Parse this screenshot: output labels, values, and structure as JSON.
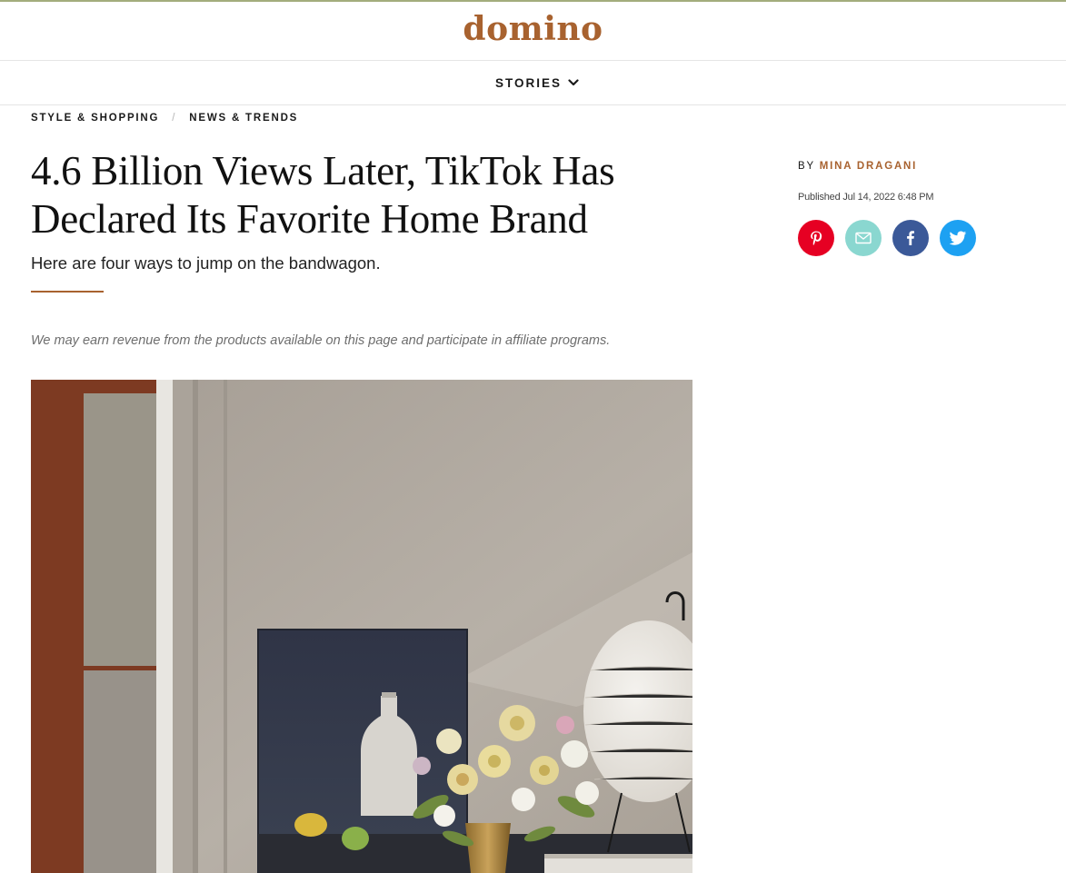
{
  "site": {
    "logo": "domino"
  },
  "nav": {
    "stories_label": "STORIES"
  },
  "breadcrumbs": [
    {
      "label": "STYLE & SHOPPING"
    },
    {
      "label": "NEWS & TRENDS"
    }
  ],
  "breadcrumb_separator": "/",
  "article": {
    "headline": "4.6 Billion Views Later, TikTok Has Declared Its Favorite Home Brand",
    "dek": "Here are four ways to jump on the bandwagon.",
    "disclaimer": "We may earn revenue from the products available on this page and participate in affiliate programs.",
    "byline_prefix": "BY",
    "author": "MINA DRAGANI",
    "published": "Published Jul 14, 2022 6:48 PM"
  },
  "share": [
    {
      "icon": "pinterest-icon",
      "color": "#e60023"
    },
    {
      "icon": "email-icon",
      "color": "#8ad7d0"
    },
    {
      "icon": "facebook-icon",
      "color": "#3b5998"
    },
    {
      "icon": "twitter-icon",
      "color": "#1da1f2"
    }
  ],
  "colors": {
    "accent": "#a8622f",
    "topbar": "#a3ad7c"
  },
  "hero_image": {
    "icon": "hero-photo"
  }
}
